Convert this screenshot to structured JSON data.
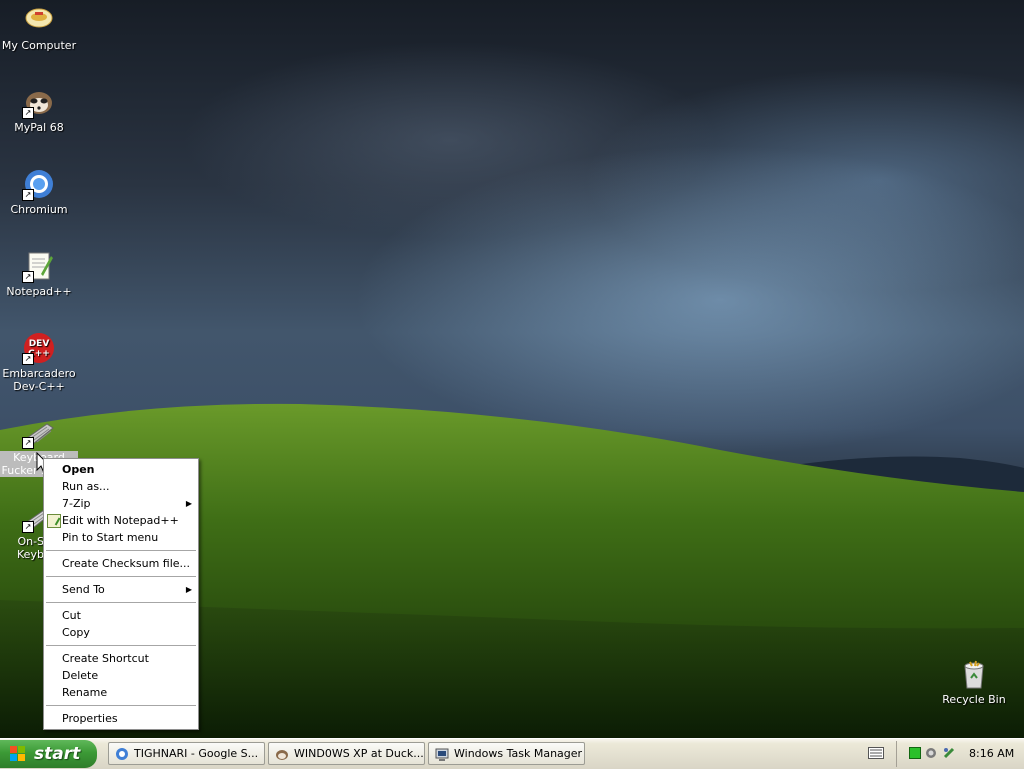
{
  "desktop": {
    "icons": [
      {
        "label": "My Computer",
        "icon": "my-computer-icon"
      },
      {
        "label": "MyPal 68",
        "icon": "mypal-icon"
      },
      {
        "label": "Chromium",
        "icon": "chromium-icon"
      },
      {
        "label": "Notepad++",
        "icon": "notepad-plus-plus-icon"
      },
      {
        "label": "Embarcadero Dev-C++",
        "icon": "dev-cpp-icon",
        "badge": "DEV C++"
      },
      {
        "label": "Keyboard Fucker 32-b...",
        "icon": "keyboard-icon",
        "selected": true
      },
      {
        "label": "On-Sc... Keybo...",
        "icon": "on-screen-keyboard-icon"
      },
      {
        "label": "Recycle Bin",
        "icon": "recycle-bin-icon"
      }
    ]
  },
  "context_menu": {
    "items": [
      {
        "label": "Open",
        "bold": true
      },
      {
        "label": "Run as..."
      },
      {
        "label": "7-Zip",
        "submenu": true
      },
      {
        "label": "Edit with Notepad++",
        "icon": "notepad-plus-plus-icon"
      },
      {
        "label": "Pin to Start menu"
      },
      {
        "separator": true
      },
      {
        "label": "Create Checksum file..."
      },
      {
        "separator": true
      },
      {
        "label": "Send To",
        "submenu": true
      },
      {
        "separator": true
      },
      {
        "label": "Cut"
      },
      {
        "label": "Copy"
      },
      {
        "separator": true
      },
      {
        "label": "Create Shortcut"
      },
      {
        "label": "Delete"
      },
      {
        "label": "Rename"
      },
      {
        "separator": true
      },
      {
        "label": "Properties"
      }
    ]
  },
  "taskbar": {
    "start_label": "start",
    "buttons": [
      {
        "label": "TIGHNARI - Google S...",
        "icon": "chromium-icon"
      },
      {
        "label": "WIND0WS XP at Duck...",
        "icon": "mypal-icon"
      },
      {
        "label": "Windows Task Manager",
        "icon": "task-manager-icon"
      }
    ],
    "clock": "8:16 AM"
  },
  "colors": {
    "start_green": "#3c9a36",
    "taskbar_bg": "#ece9d8",
    "selection_grey": "#bcbcbc"
  }
}
